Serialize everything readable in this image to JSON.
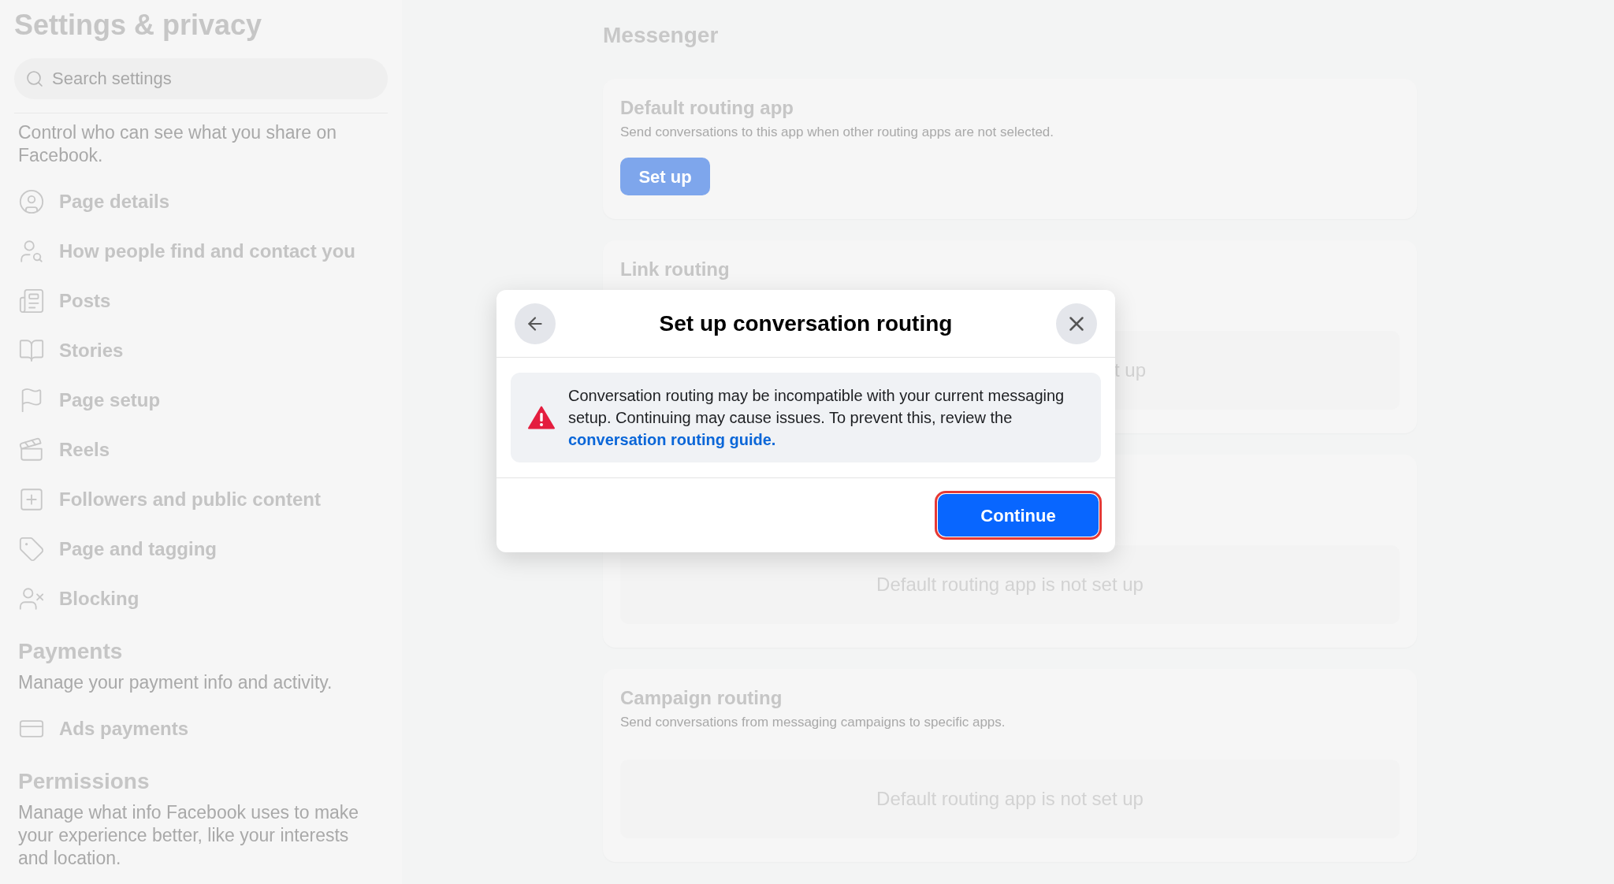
{
  "sidebar": {
    "title": "Settings & privacy",
    "search": {
      "placeholder": "Search settings"
    },
    "sections": [
      {
        "description": "Control who can see what you share on Facebook.",
        "items": [
          {
            "label": "Page details",
            "kind": "profile"
          },
          {
            "label": "How people find and contact you",
            "kind": "find"
          },
          {
            "label": "Posts",
            "kind": "posts"
          },
          {
            "label": "Stories",
            "kind": "stories"
          },
          {
            "label": "Page setup",
            "kind": "flag"
          },
          {
            "label": "Reels",
            "kind": "reels"
          },
          {
            "label": "Followers and public content",
            "kind": "followers"
          },
          {
            "label": "Page and tagging",
            "kind": "tag"
          },
          {
            "label": "Blocking",
            "kind": "block"
          }
        ]
      },
      {
        "heading": "Payments",
        "description": "Manage your payment info and activity.",
        "items": [
          {
            "label": "Ads payments",
            "kind": "card"
          }
        ]
      },
      {
        "heading": "Permissions",
        "description": "Manage what info Facebook uses to make your experience better, like your interests and location."
      }
    ]
  },
  "main": {
    "title": "Messenger",
    "cards": [
      {
        "kind": "button",
        "title": "Default routing app",
        "description": "Send conversations to this app when other routing apps are not selected.",
        "button": "Set up"
      },
      {
        "kind": "status_partial",
        "title": "Link routing",
        "status": "t up"
      },
      {
        "kind": "status",
        "status": "Default routing app is not set up"
      },
      {
        "kind": "status",
        "title": "Campaign routing",
        "description": "Send conversations from messaging campaigns to specific apps.",
        "status": "Default routing app is not set up"
      }
    ]
  },
  "dialog": {
    "title": "Set up conversation routing",
    "warning": {
      "text": "Conversation routing may be incompatible with your current messaging setup. Continuing may cause issues. To prevent this, review the ",
      "link": "conversation routing guide."
    },
    "button": {
      "label": "Continue",
      "highlighted": true
    }
  }
}
